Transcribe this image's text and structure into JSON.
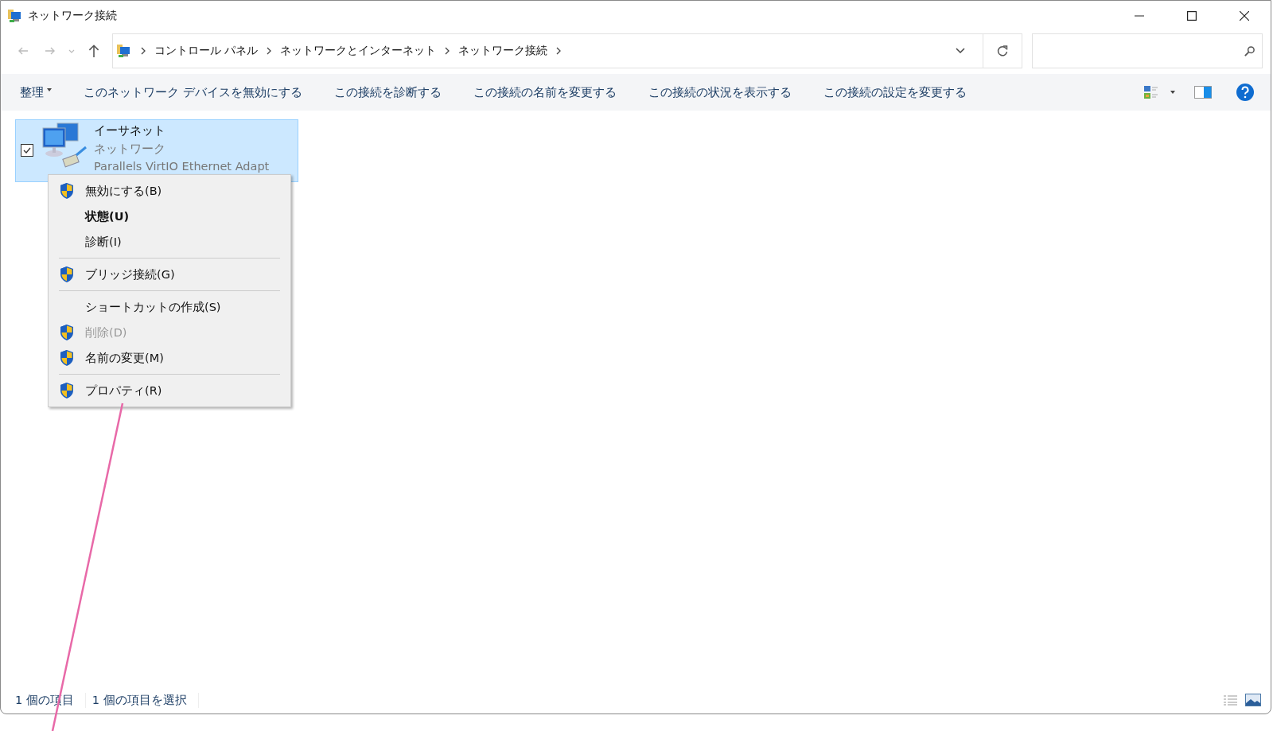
{
  "window": {
    "title": "ネットワーク接続"
  },
  "breadcrumb": [
    "コントロール パネル",
    "ネットワークとインターネット",
    "ネットワーク接続"
  ],
  "toolbar": {
    "organize": "整理",
    "commands": [
      "このネットワーク デバイスを無効にする",
      "この接続を診断する",
      "この接続の名前を変更する",
      "この接続の状況を表示する",
      "この接続の設定を変更する"
    ]
  },
  "connection": {
    "name": "イーサネット",
    "network": "ネットワーク",
    "adapter": "Parallels VirtIO Ethernet Adapt",
    "selected": true,
    "checked": true
  },
  "context_menu": [
    {
      "kind": "item",
      "label": "無効にする(B)",
      "shield": true,
      "bold": false,
      "disabled": false
    },
    {
      "kind": "item",
      "label": "状態(U)",
      "shield": false,
      "bold": true,
      "disabled": false
    },
    {
      "kind": "item",
      "label": "診断(I)",
      "shield": false,
      "bold": false,
      "disabled": false
    },
    {
      "kind": "separator"
    },
    {
      "kind": "item",
      "label": "ブリッジ接続(G)",
      "shield": true,
      "bold": false,
      "disabled": false
    },
    {
      "kind": "separator"
    },
    {
      "kind": "item",
      "label": "ショートカットの作成(S)",
      "shield": false,
      "bold": false,
      "disabled": false
    },
    {
      "kind": "item",
      "label": "削除(D)",
      "shield": true,
      "bold": false,
      "disabled": true
    },
    {
      "kind": "item",
      "label": "名前の変更(M)",
      "shield": true,
      "bold": false,
      "disabled": false
    },
    {
      "kind": "separator"
    },
    {
      "kind": "item",
      "label": "プロパティ(R)",
      "shield": true,
      "bold": false,
      "disabled": false
    }
  ],
  "status_bar": [
    "1 個の項目",
    "1 個の項目を選択"
  ]
}
